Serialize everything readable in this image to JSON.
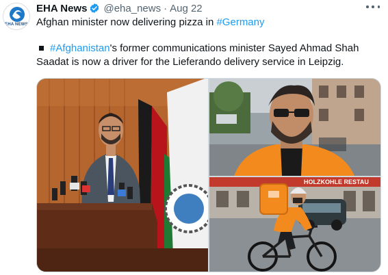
{
  "tweet": {
    "author": {
      "name": "EHA News",
      "handle": "@eha_news",
      "avatar_text": "EHA NEWS",
      "verified": true
    },
    "separator": "·",
    "date": "Aug 22",
    "line1": {
      "text": "Afghan minister now delivering pizza in ",
      "hashtag": "#Germany"
    },
    "line2": {
      "hashtag": "#Afghanistan",
      "text": "'s former communications minister Sayed Ahmad Shah Saadat is now a driver for the Lieferando delivery service in Leipzig."
    },
    "photo_sign_text": "HOLZKOHLE RESTAU",
    "colors": {
      "link": "#1d9bf0",
      "verified": "#1d9bf0",
      "secondary_text": "#536471",
      "delivery_orange": "#f28a1e"
    },
    "icons": [
      "verified-badge-icon",
      "more-options-icon",
      "bullet-icon"
    ]
  }
}
